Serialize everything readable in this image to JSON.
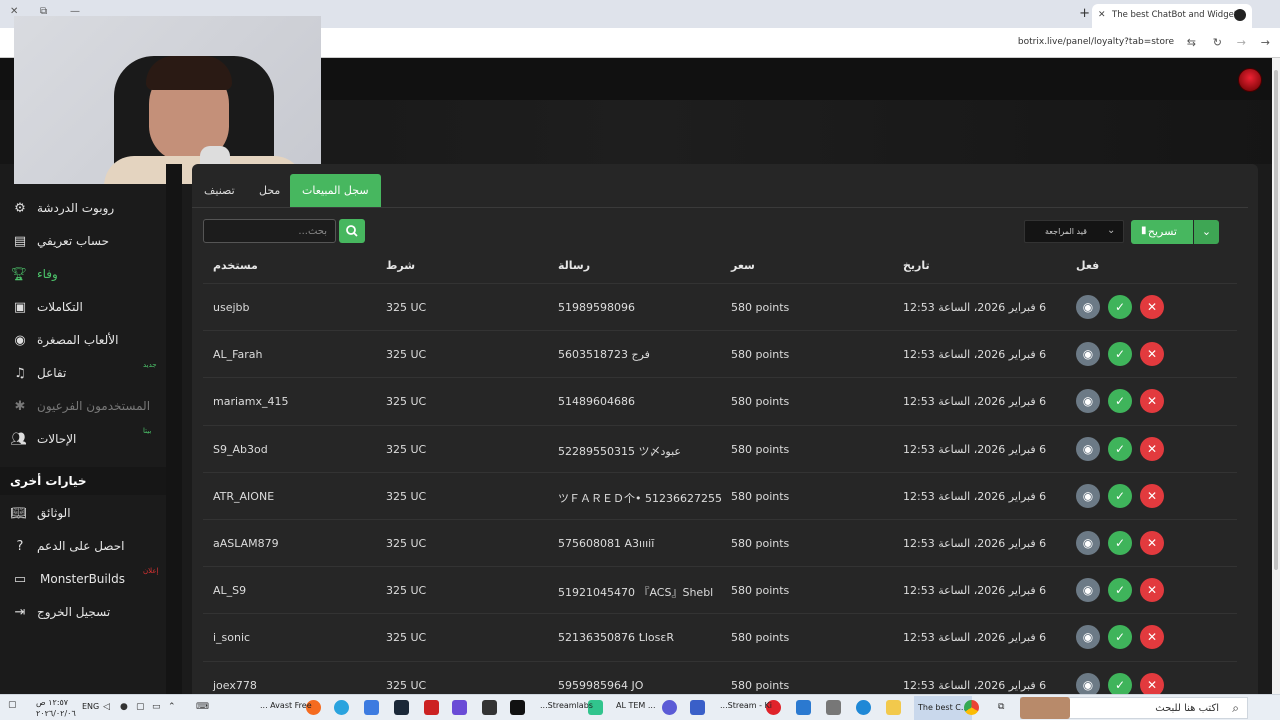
{
  "browser": {
    "tab_title": "The best ChatBot and Widgets",
    "tab_close": "✕",
    "new_tab": "+",
    "url": "botrix.live/panel/loyalty?tab=store",
    "win_close": "✕",
    "win_restore": "⧉",
    "win_min": "—"
  },
  "sidebar": {
    "items": [
      {
        "label": "روبوت الدردشة",
        "icon": "robot-icon"
      },
      {
        "label": "حساب تعريفي",
        "icon": "id-card-icon"
      },
      {
        "label": "وفاء",
        "icon": "trophy-icon"
      },
      {
        "label": "التكاملات",
        "icon": "integrations-icon"
      },
      {
        "label": "الألعاب المصغرة",
        "icon": "gamepad-icon"
      },
      {
        "label": "تفاعل",
        "icon": "music-icon",
        "badge": "جديد"
      },
      {
        "label": "المستخدمون الفرعيون",
        "icon": "settings-icon"
      },
      {
        "label": "الإحالات",
        "icon": "users-icon",
        "badge": "بيتا"
      }
    ],
    "section_title": "خيارات أخرى",
    "other_items": [
      {
        "label": "الوثائق",
        "icon": "book-icon"
      },
      {
        "label": "احصل على الدعم",
        "icon": "help-icon"
      },
      {
        "label": "MonsterBuilds",
        "icon": "monitor-icon",
        "badge": "إعلان"
      },
      {
        "label": "تسجيل الخروج",
        "icon": "logout-icon"
      }
    ]
  },
  "tabs": [
    {
      "label": "سجل المبيعات",
      "active": true
    },
    {
      "label": "محل",
      "active": false
    },
    {
      "label": "تصنيف",
      "active": false
    }
  ],
  "toolbar": {
    "search_placeholder": "بحث...",
    "filter_value": "قيد المراجعة",
    "export_label": "تسريح"
  },
  "table": {
    "headers": {
      "user": "مستخدم",
      "condition": "شرط",
      "message": "رسالة",
      "price": "سعر",
      "date": "تاريخ",
      "action": "فعل"
    },
    "rows": [
      {
        "user": "usejbb",
        "condition": "325 UC",
        "message": "51989598096",
        "price": "580 points",
        "date": "6 فبراير 2026، الساعة 12:53"
      },
      {
        "user": "AL_Farah",
        "condition": "325 UC",
        "message": "5603518723 فرج",
        "price": "580 points",
        "date": "6 فبراير 2026، الساعة 12:53"
      },
      {
        "user": "mariamx_415",
        "condition": "325 UC",
        "message": "51489604686",
        "price": "580 points",
        "date": "6 فبراير 2026، الساعة 12:53"
      },
      {
        "user": "S9_Ab3od",
        "condition": "325 UC",
        "message": "52289550315 ツ〆عبود",
        "price": "580 points",
        "date": "6 فبراير 2026، الساعة 12:53"
      },
      {
        "user": "ATR_AIONE",
        "condition": "325 UC",
        "message": "ツＦＡＲＥＤ个• 51236627255",
        "price": "580 points",
        "date": "6 فبراير 2026، الساعة 12:53"
      },
      {
        "user": "aASLAM879",
        "condition": "325 UC",
        "message": "575608081 A3ıııiī",
        "price": "580 points",
        "date": "6 فبراير 2026، الساعة 12:53"
      },
      {
        "user": "AL_S9",
        "condition": "325 UC",
        "message": "51921045470 『ACS』Shebl",
        "price": "580 points",
        "date": "6 فبراير 2026، الساعة 12:53"
      },
      {
        "user": "i_sonic",
        "condition": "325 UC",
        "message": "52136350876 ꝈlosεR",
        "price": "580 points",
        "date": "6 فبراير 2026، الساعة 12:53"
      },
      {
        "user": "joex778",
        "condition": "325 UC",
        "message": "5959985964 JO",
        "price": "580 points",
        "date": "6 فبراير 2026، الساعة 12:53"
      }
    ]
  },
  "taskbar": {
    "search_text": "اكتب هنا للبحث",
    "clock_time": "١٢:٥٧ ص",
    "clock_date": "٢٠٢٦/٠٢/٠٦",
    "lang": "ENG",
    "apps": [
      "... Avast Free",
      "...Streamlabs",
      "AL TEM ...",
      "...Stream - Ki",
      "The best C..."
    ]
  },
  "colors": {
    "accent_green": "#47b75f",
    "reject_red": "#e23a3e",
    "view_gray": "#6c7a86"
  }
}
